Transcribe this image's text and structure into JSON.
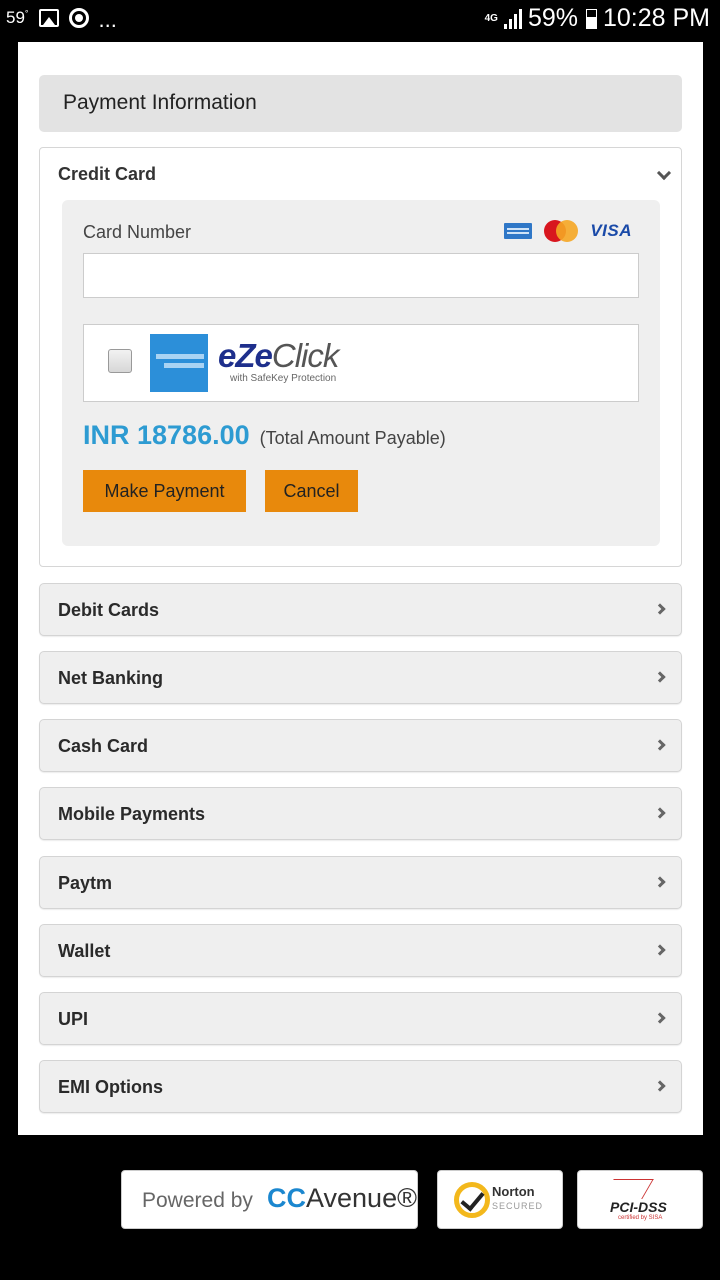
{
  "status_bar": {
    "temperature": "59",
    "temperature_unit": "°",
    "overflow": "...",
    "network": "4G",
    "battery": "59%",
    "time": "10:28 PM",
    "icons": [
      "gallery-icon",
      "chrome-icon",
      "signal-icon",
      "battery-icon"
    ]
  },
  "header": {
    "title": "Payment Information"
  },
  "credit_card": {
    "title": "Credit Card",
    "expanded": true,
    "card_number_label": "Card Number",
    "card_number_value": "",
    "card_number_placeholder": "",
    "accepted_cards": [
      "American Express",
      "MasterCard",
      "VISA"
    ],
    "visa_label": "VISA",
    "ezeclick": {
      "checked": false,
      "brand_prefix": "eZe",
      "brand_suffix": "Click",
      "subtitle": "with SafeKey Protection"
    },
    "amount": "INR 18786.00",
    "amount_note": "(Total Amount Payable)",
    "make_payment_label": "Make Payment",
    "cancel_label": "Cancel",
    "button_color": "#e8890c",
    "amount_color": "#2d9bd2"
  },
  "methods": [
    {
      "label": "Debit Cards"
    },
    {
      "label": "Net Banking"
    },
    {
      "label": "Cash Card"
    },
    {
      "label": "Mobile Payments"
    },
    {
      "label": "Paytm"
    },
    {
      "label": "Wallet"
    },
    {
      "label": "UPI"
    },
    {
      "label": "EMI Options"
    }
  ],
  "footer": {
    "powered_by": "Powered by",
    "ccavenue_cc": "CC",
    "ccavenue_rest": "Avenue®",
    "norton_title": "Norton",
    "norton_sub": "SECURED",
    "pci_title": "PCI-DSS",
    "pci_sub": "certified by SISA"
  }
}
